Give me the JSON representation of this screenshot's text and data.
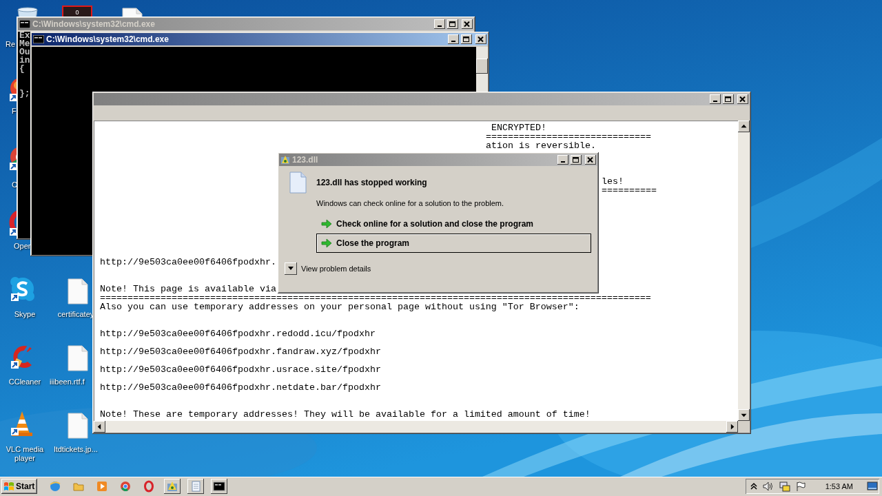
{
  "desktop_icons": [
    {
      "kind": "bin",
      "label": "Re"
    },
    {
      "kind": "counter",
      "label": "0"
    },
    {
      "kind": "file"
    },
    {
      "kind": "ball",
      "label": "F"
    },
    {
      "kind": "pinwheel",
      "label": "C"
    },
    {
      "kind": "ring",
      "label": "Oper"
    },
    {
      "kind": "cloud",
      "label": "Skype"
    },
    {
      "kind": "file",
      "label": "certificatey"
    },
    {
      "kind": "broom",
      "label": "CCleaner"
    },
    {
      "kind": "file",
      "label": "iiibeen.rtf.f"
    },
    {
      "kind": "cone",
      "label": "VLC media player"
    },
    {
      "kind": "file",
      "label": "ltdtickets.jp..."
    }
  ],
  "cmd_windows": [
    {
      "title": "C:\\Windows\\system32\\cmd.exe",
      "active": false,
      "lines": [
        "Ex",
        "Me",
        "Ou",
        "in",
        "{",
        "};"
      ]
    },
    {
      "title": "C:\\Windows\\system32\\cmd.exe",
      "active": true
    }
  ],
  "notepad": {
    "active": false,
    "lines": [
      "ENCRYPTED!",
      "==============================",
      "ation is reversible.",
      "les!",
      "==========",
      "http://9e503ca0ee00f6406fpodxhr.",
      "Note! This page is available via",
      "====================================================================================================",
      "Also you can use temporary addresses on your personal page without using \"Tor Browser\":",
      "http://9e503ca0ee00f6406fpodxhr.redodd.icu/fpodxhr",
      "http://9e503ca0ee00f6406fpodxhr.fandraw.xyz/fpodxhr",
      "http://9e503ca0ee00f6406fpodxhr.usrace.site/fpodxhr",
      "http://9e503ca0ee00f6406fpodxhr.netdate.bar/fpodxhr",
      "Note! These are temporary addresses! They will be available for a limited amount of time!"
    ]
  },
  "dialog": {
    "title": "123.dll",
    "active": false,
    "heading": "123.dll has stopped working",
    "message": "Windows can check online for a solution to the problem.",
    "options": [
      {
        "label": "Check online for a solution and close the program",
        "selected": false
      },
      {
        "label": "Close the program",
        "selected": true
      }
    ],
    "details": "View problem details"
  },
  "taskbar": {
    "start": "Start",
    "clock": "1:53 AM"
  }
}
